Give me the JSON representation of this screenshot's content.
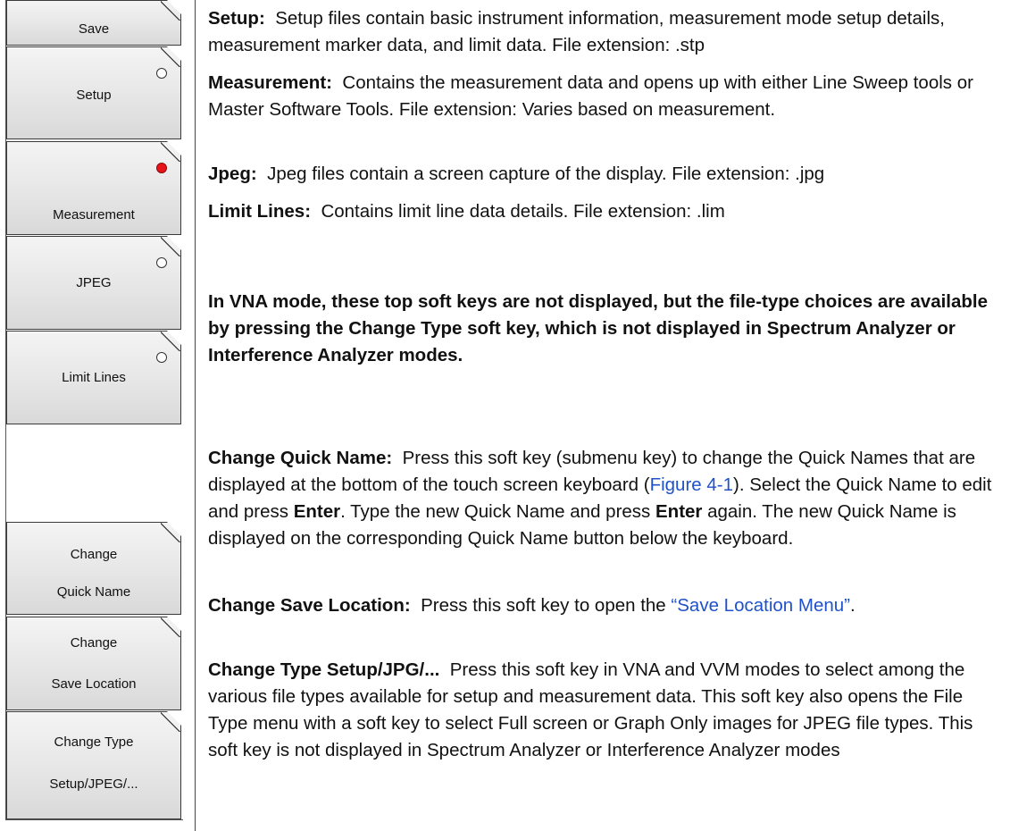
{
  "softkeys": {
    "title": "Save",
    "setup": "Setup",
    "measurement": "Measurement",
    "jpeg": "JPEG",
    "limit_lines": "Limit Lines",
    "change_quick_name": [
      "Change",
      "Quick Name"
    ],
    "change_save_location": [
      "Change",
      "Save Location"
    ],
    "change_type": [
      "Change Type",
      "Setup/JPEG/..."
    ],
    "selected": "Measurement"
  },
  "colors": {
    "radio_selected": "#e8121b",
    "link": "#1f52c9"
  },
  "descriptions": {
    "setup": {
      "term": "Setup:",
      "text": "Setup files contain basic instrument information, measurement mode setup details, measurement marker data, and limit data. File extension: .stp"
    },
    "measurement": {
      "term": "Measurement:",
      "text": "Contains the measurement data and opens up with either Line Sweep tools or Master Software Tools. File extension: Varies based on measurement."
    },
    "jpeg": {
      "term": "Jpeg:",
      "text": "Jpeg files contain a screen capture of the display. File extension: .jpg"
    },
    "limit_lines": {
      "term": "Limit Lines:",
      "text": "Contains limit line data details. File extension: .lim"
    },
    "vna_note": "In VNA mode, these top soft keys are not displayed, but the file-type choices are available by pressing the Change Type soft key, which is not displayed in Spectrum Analyzer or Interference Analyzer modes.",
    "change_quick_name": {
      "term": "Change Quick Name:",
      "text_1": "Press this soft key (submenu key) to change the Quick Names that are displayed at the bottom of the touch screen keyboard (",
      "link": "Figure 4-1",
      "text_2": "). Select the Quick Name to edit and press ",
      "enter_1": "Enter",
      "text_3": ". Type the new Quick Name and press ",
      "enter_2": "Enter",
      "text_4": " again. The new Quick Name is displayed on the corresponding Quick Name button below the keyboard."
    },
    "change_save_location": {
      "term": "Change Save Location:",
      "text": "Press this soft key to open the ",
      "link": "“Save Location Menu”",
      "end": "."
    },
    "change_type": {
      "term": "Change Type Setup/JPG/...",
      "text": "Press this soft key in VNA and VVM modes to select among the various file types available for setup and measurement data. This soft key also opens the File Type menu with a soft key to select Full screen or Graph Only images for JPEG file types. This soft key is not displayed in Spectrum Analyzer or Interference Analyzer modes"
    }
  }
}
